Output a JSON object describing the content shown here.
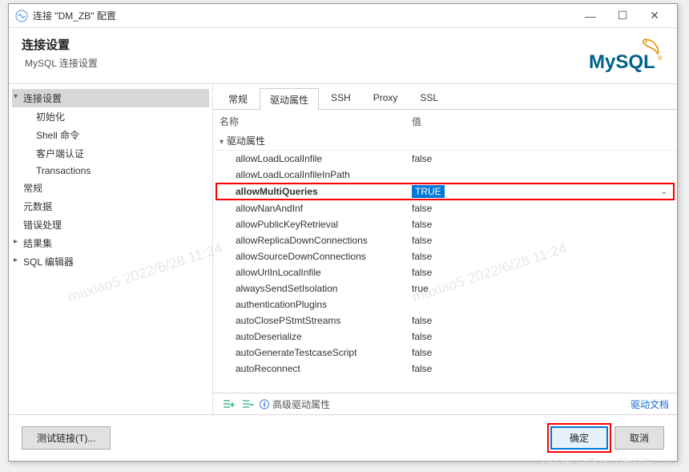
{
  "titlebar": {
    "title": "连接 \"DM_ZB\" 配置"
  },
  "header": {
    "title": "连接设置",
    "subtitle": "MySQL 连接设置",
    "brand": "MySQL"
  },
  "sidebar": {
    "items": [
      {
        "label": "连接设置",
        "expandable": true,
        "selected": true
      },
      {
        "label": "初始化",
        "sub": true
      },
      {
        "label": "Shell 命令",
        "sub": true
      },
      {
        "label": "客户端认证",
        "sub": true
      },
      {
        "label": "Transactions",
        "sub": true
      },
      {
        "label": "常规"
      },
      {
        "label": "元数据"
      },
      {
        "label": "错误处理"
      },
      {
        "label": "结果集",
        "expandable": true
      },
      {
        "label": "SQL 编辑器",
        "expandable": true
      }
    ]
  },
  "tabs": [
    {
      "label": "常规",
      "active": false
    },
    {
      "label": "驱动属性",
      "active": true
    },
    {
      "label": "SSH",
      "active": false
    },
    {
      "label": "Proxy",
      "active": false
    },
    {
      "label": "SSL",
      "active": false
    }
  ],
  "table": {
    "name_header": "名称",
    "value_header": "值",
    "root_label": "驱动属性",
    "rows": [
      {
        "name": "allowLoadLocalInfile",
        "value": "false"
      },
      {
        "name": "allowLoadLocalInfileInPath",
        "value": ""
      },
      {
        "name": "allowMultiQueries",
        "value": "TRUE",
        "highlighted": true
      },
      {
        "name": "allowNanAndInf",
        "value": "false"
      },
      {
        "name": "allowPublicKeyRetrieval",
        "value": "false"
      },
      {
        "name": "allowReplicaDownConnections",
        "value": "false"
      },
      {
        "name": "allowSourceDownConnections",
        "value": "false"
      },
      {
        "name": "allowUrlInLocalInfile",
        "value": "false"
      },
      {
        "name": "alwaysSendSetIsolation",
        "value": "true"
      },
      {
        "name": "authenticationPlugins",
        "value": ""
      },
      {
        "name": "autoClosePStmtStreams",
        "value": "false"
      },
      {
        "name": "autoDeserialize",
        "value": "false"
      },
      {
        "name": "autoGenerateTestcaseScript",
        "value": "false"
      },
      {
        "name": "autoReconnect",
        "value": "false"
      }
    ]
  },
  "toolbar": {
    "advanced": "高级驱动属性",
    "doc_link": "驱动文档"
  },
  "buttons": {
    "test": "测试链接(T)...",
    "ok": "确定",
    "cancel": "取消"
  },
  "watermark": "maxiao5 2022/6/28 11:24",
  "csdn": "CSDN @晓之以理的喵~~"
}
